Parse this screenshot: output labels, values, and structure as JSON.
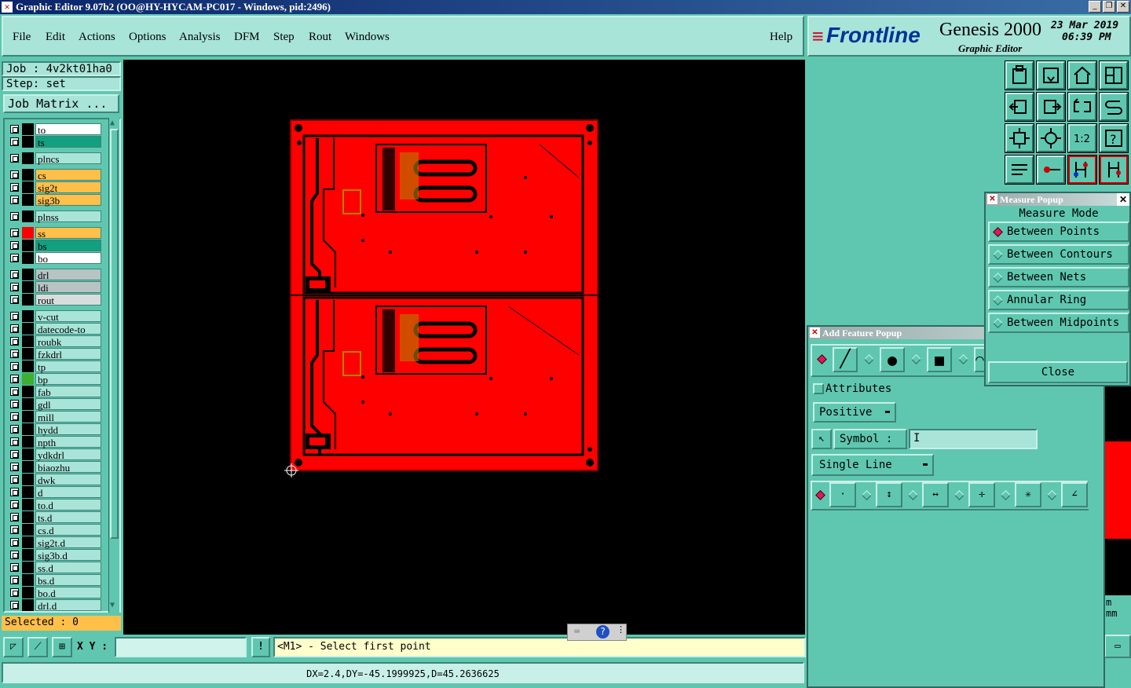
{
  "window": {
    "title": "Graphic Editor 9.07b2 (OO@HY-HYCAM-PC017 - Windows, pid:2496)",
    "icon": "x-window-icon",
    "controls": [
      "_",
      "□",
      "✕"
    ]
  },
  "menu": {
    "items": [
      "File",
      "Edit",
      "Actions",
      "Options",
      "Analysis",
      "DFM",
      "Step",
      "Rout",
      "Windows"
    ],
    "help": "Help"
  },
  "logo": {
    "brand": "Frontline",
    "product": "Genesis 2000",
    "subtitle": "Graphic Editor",
    "date": "23 Mar 2019",
    "time": "06:39 PM"
  },
  "job": {
    "job_label": "Job : 4v2kt01ha0",
    "step_label": "Step: set",
    "matrix_button": "Job Matrix ..."
  },
  "layers": [
    {
      "name": "to",
      "color": "#ffffff",
      "swatch": "#000000"
    },
    {
      "name": "ts",
      "color": "#12a080",
      "swatch": "#000000"
    },
    {
      "name": "plncs",
      "color": "#a8e4d8",
      "swatch": "#000000"
    },
    {
      "name": "cs",
      "color": "#ffc04a",
      "swatch": "#000000"
    },
    {
      "name": "sig2t",
      "color": "#ffc04a",
      "swatch": "#000000"
    },
    {
      "name": "sig3b",
      "color": "#ffc04a",
      "swatch": "#000000"
    },
    {
      "name": "plnss",
      "color": "#a8e4d8",
      "swatch": "#000000"
    },
    {
      "name": "ss",
      "color": "#ffc04a",
      "swatch": "#ff0000"
    },
    {
      "name": "bs",
      "color": "#12a080",
      "swatch": "#000000"
    },
    {
      "name": "bo",
      "color": "#ffffff",
      "swatch": "#000000"
    },
    {
      "name": "drl",
      "color": "#b8c4c4",
      "swatch": "#000000"
    },
    {
      "name": "ldi",
      "color": "#b8c4c4",
      "swatch": "#000000"
    },
    {
      "name": "rout",
      "color": "#d8dcdc",
      "swatch": "#000000"
    },
    {
      "name": "v-cut",
      "color": "#a8e4d8",
      "swatch": "#000000"
    },
    {
      "name": "datecode-to",
      "color": "#a8e4d8",
      "swatch": "#000000"
    },
    {
      "name": "roubk",
      "color": "#a8e4d8",
      "swatch": "#000000"
    },
    {
      "name": "fzkdrl",
      "color": "#a8e4d8",
      "swatch": "#000000"
    },
    {
      "name": "tp",
      "color": "#a8e4d8",
      "swatch": "#000000"
    },
    {
      "name": "bp",
      "color": "#a8e4d8",
      "swatch": "#3cb030"
    },
    {
      "name": "fab",
      "color": "#a8e4d8",
      "swatch": "#000000"
    },
    {
      "name": "gdl",
      "color": "#a8e4d8",
      "swatch": "#000000"
    },
    {
      "name": "mill",
      "color": "#a8e4d8",
      "swatch": "#000000"
    },
    {
      "name": "hydd",
      "color": "#a8e4d8",
      "swatch": "#000000"
    },
    {
      "name": "npth",
      "color": "#a8e4d8",
      "swatch": "#000000"
    },
    {
      "name": "ydkdrl",
      "color": "#a8e4d8",
      "swatch": "#000000"
    },
    {
      "name": "biaozhu",
      "color": "#a8e4d8",
      "swatch": "#000000"
    },
    {
      "name": "dwk",
      "color": "#a8e4d8",
      "swatch": "#000000"
    },
    {
      "name": "d",
      "color": "#a8e4d8",
      "swatch": "#000000"
    },
    {
      "name": "to.d",
      "color": "#a8e4d8",
      "swatch": "#000000"
    },
    {
      "name": "ts.d",
      "color": "#a8e4d8",
      "swatch": "#000000"
    },
    {
      "name": "cs.d",
      "color": "#a8e4d8",
      "swatch": "#000000"
    },
    {
      "name": "sig2t.d",
      "color": "#a8e4d8",
      "swatch": "#000000"
    },
    {
      "name": "sig3b.d",
      "color": "#a8e4d8",
      "swatch": "#000000"
    },
    {
      "name": "ss.d",
      "color": "#a8e4d8",
      "swatch": "#000000"
    },
    {
      "name": "bs.d",
      "color": "#a8e4d8",
      "swatch": "#000000"
    },
    {
      "name": "bo.d",
      "color": "#a8e4d8",
      "swatch": "#000000"
    },
    {
      "name": "drl.d",
      "color": "#a8e4d8",
      "swatch": "#000000"
    }
  ],
  "selected": "Selected : 0",
  "toolbar_bottom": {
    "xy_label": "X Y :",
    "xy_value": "",
    "prompt": "<M1> - Select first point"
  },
  "status": "DX=2.4,DY=-45.1999925,D=45.2636625",
  "measure_popup": {
    "title": "Measure Popup",
    "heading": "Measure Mode",
    "modes": [
      "Between Points",
      "Between Contours",
      "Between Nets",
      "Annular Ring",
      "Between Midpoints"
    ],
    "selected_index": 0,
    "close": "Close"
  },
  "add_feature_popup": {
    "title": "Add Feature Popup",
    "attributes": "Attributes",
    "polarity": "Positive",
    "symbol_label": "Symbol :",
    "symbol_value": "",
    "line_mode": "Single Line"
  },
  "right_edge": {
    "label_top": "m",
    "label_bottom": "mm"
  },
  "colors": {
    "board": "#ff0000",
    "canvas": "#000000",
    "panel": "#5fc7b0",
    "light_panel": "#a8e4d8",
    "selected": "#d81b60"
  }
}
